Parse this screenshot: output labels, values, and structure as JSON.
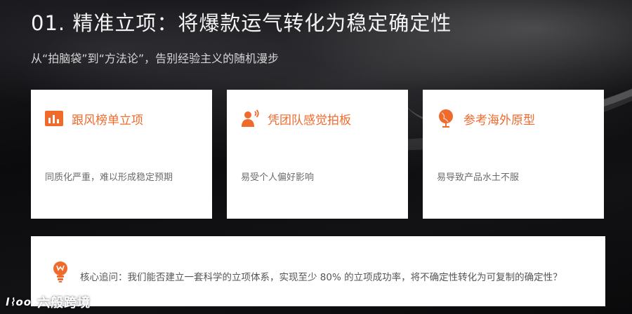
{
  "slide": {
    "title": "01. 精准立项：将爆款运气转化为稳定确定性",
    "subtitle": "从“拍脑袋”到“方法论”，告别经验主义的随机漫步"
  },
  "cards": [
    {
      "icon": "bar-chart-icon",
      "title": "跟风榜单立项",
      "desc": "同质化严重，难以形成稳定预期"
    },
    {
      "icon": "person-speaking-icon",
      "title": "凭团队感觉拍板",
      "desc": "易受个人偏好影响"
    },
    {
      "icon": "globe-icon",
      "title": "参考海外原型",
      "desc": "易导致产品水土不服"
    }
  ],
  "core_question": {
    "icon": "lightbulb-icon",
    "text": "核心追问：我们能否建立一套科学的立项体系，实现至少 80% 的立项成功率，将不确定性转化为可复制的确定性？"
  },
  "watermark": {
    "logo": "l⌇oo",
    "text": "六般跨境"
  },
  "colors": {
    "accent": "#f06a2c",
    "card_bg": "#ffffff",
    "title_text": "#f4f4f4",
    "desc_text": "#6b6b6b"
  }
}
